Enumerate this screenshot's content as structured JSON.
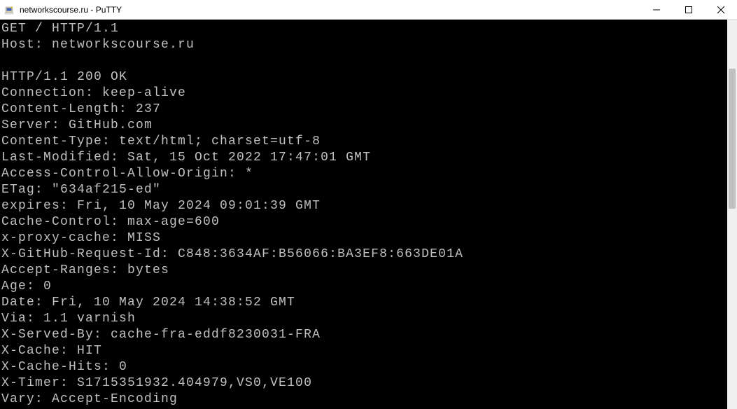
{
  "window": {
    "title": "networkscourse.ru - PuTTY"
  },
  "terminal": {
    "lines": [
      "GET / HTTP/1.1",
      "Host: networkscourse.ru",
      "",
      "HTTP/1.1 200 OK",
      "Connection: keep-alive",
      "Content-Length: 237",
      "Server: GitHub.com",
      "Content-Type: text/html; charset=utf-8",
      "Last-Modified: Sat, 15 Oct 2022 17:47:01 GMT",
      "Access-Control-Allow-Origin: *",
      "ETag: \"634af215-ed\"",
      "expires: Fri, 10 May 2024 09:01:39 GMT",
      "Cache-Control: max-age=600",
      "x-proxy-cache: MISS",
      "X-GitHub-Request-Id: C848:3634AF:B56066:BA3EF8:663DE01A",
      "Accept-Ranges: bytes",
      "Age: 0",
      "Date: Fri, 10 May 2024 14:38:52 GMT",
      "Via: 1.1 varnish",
      "X-Served-By: cache-fra-eddf8230031-FRA",
      "X-Cache: HIT",
      "X-Cache-Hits: 0",
      "X-Timer: S1715351932.404979,VS0,VE100",
      "Vary: Accept-Encoding"
    ]
  }
}
